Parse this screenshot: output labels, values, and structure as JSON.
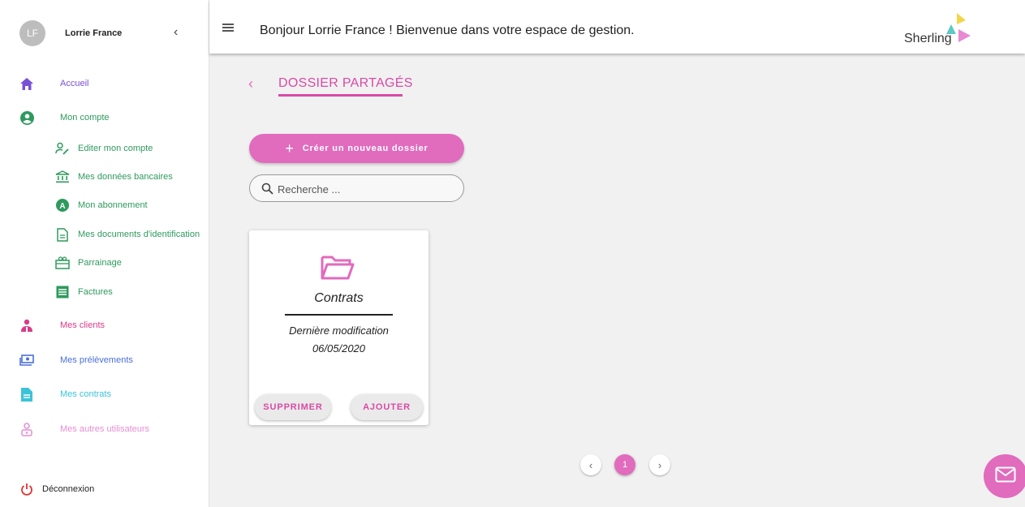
{
  "profile": {
    "initials": "LF",
    "name": "Lorrie France"
  },
  "header": {
    "welcome": "Bonjour Lorrie France ! Bienvenue dans votre espace de gestion.",
    "logo_text": "Sherling"
  },
  "sidebar": {
    "items": [
      {
        "label": "Accueil",
        "color": "#7b4fd6",
        "icon": "home-icon"
      },
      {
        "label": "Mon compte",
        "color": "#2e9a5e",
        "icon": "account-circle-icon"
      },
      {
        "label": "Mes clients",
        "color": "#d93a8a",
        "icon": "clients-icon"
      },
      {
        "label": "Mes prélèvements",
        "color": "#4a6fd8",
        "icon": "money-icon"
      },
      {
        "label": "Mes contrats",
        "color": "#3cc3d8",
        "icon": "document-icon"
      },
      {
        "label": "Mes autres utilisateurs",
        "color": "#e38fd2",
        "icon": "user-outline-icon"
      }
    ],
    "subitems": [
      {
        "label": "Editer mon compte",
        "icon": "edit-user-icon"
      },
      {
        "label": "Mes données bancaires",
        "icon": "bank-icon"
      },
      {
        "label": "Mon abonnement",
        "icon": "subscription-icon"
      },
      {
        "label": "Mes documents d'identification",
        "icon": "file-icon"
      },
      {
        "label": "Parrainage",
        "icon": "gift-icon"
      },
      {
        "label": "Factures",
        "icon": "invoice-icon"
      }
    ],
    "logout": "Déconnexion"
  },
  "main": {
    "title": "DOSSIER PARTAGÉS",
    "create_button": "Créer un nouveau dossier",
    "search_placeholder": "Recherche ...",
    "folder": {
      "name": "Contrats",
      "modified_label": "Dernière modification",
      "modified_date": "06/05/2020",
      "delete_label": "SUPPRIMER",
      "add_label": "AJOUTER"
    },
    "pagination": {
      "current": "1"
    }
  },
  "colors": {
    "accent": "#e16bbd",
    "green": "#2e9a5e"
  }
}
